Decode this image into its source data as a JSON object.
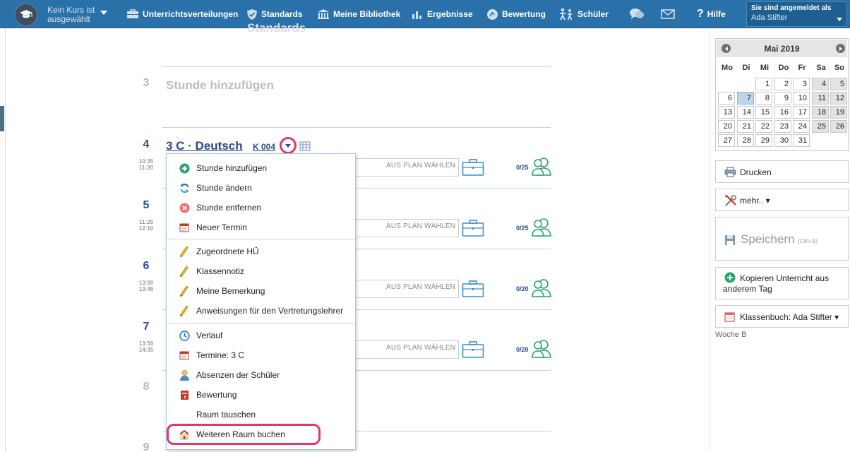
{
  "topbar": {
    "kurs_line1": "Kein Kurs ist",
    "kurs_line2": "ausgewählt",
    "nav": [
      {
        "label": "Unterrichtsverteilungen",
        "icon": "briefcase-icon"
      },
      {
        "label": "Standards",
        "icon": "shield-check-icon"
      },
      {
        "label": "Meine Bibliothek",
        "icon": "library-icon"
      },
      {
        "label": "Ergebnisse",
        "icon": "bar-chart-icon"
      },
      {
        "label": "Bewertung",
        "icon": "gauge-icon"
      },
      {
        "label": "Schüler",
        "icon": "students-icon"
      }
    ],
    "help_label": "Hilfe",
    "user_line1": "Sie sind angemeldet als",
    "user_name": "Ada Stifter"
  },
  "lessons": {
    "slot3": {
      "number": "3",
      "add_label": "Stunde hinzufügen"
    },
    "slot4": {
      "number": "4",
      "start": "10:35",
      "end": "11:20",
      "title": "3 C · Deutsch",
      "room": "K 004",
      "plan_label": "AUS PLAN WÄHLEN",
      "count": "0/25"
    },
    "slot5": {
      "number": "5",
      "start": "11:25",
      "end": "12:10",
      "plan_label": "AUS PLAN WÄHLEN",
      "count": "0/25"
    },
    "slot6": {
      "number": "6",
      "start": "13:00",
      "end": "13:45",
      "plan_label": "AUS PLAN WÄHLEN",
      "count": "0/20"
    },
    "slot7": {
      "number": "7",
      "start": "13:50",
      "end": "14:35",
      "plan_label": "AUS PLAN WÄHLEN",
      "count": "0/20"
    },
    "slot8": {
      "number": "8"
    },
    "slot9": {
      "number": "9"
    }
  },
  "menu": {
    "items": [
      {
        "label": "Stunde hinzufügen",
        "icon": "plus-circle-icon"
      },
      {
        "label": "Stunde ändern",
        "icon": "refresh-icon"
      },
      {
        "label": "Stunde entfernen",
        "icon": "remove-circle-icon"
      },
      {
        "label": "Neuer Termin",
        "icon": "calendar-page-icon"
      },
      {
        "label": "Zugeordnete HÜ",
        "icon": "pencil-icon"
      },
      {
        "label": "Klassennotiz",
        "icon": "pencil-icon"
      },
      {
        "label": "Meine Bemerkung",
        "icon": "pencil-icon"
      },
      {
        "label": "Anweisungen für den Vertretungslehrer",
        "icon": "pencil-icon"
      },
      {
        "label": "Verlauf",
        "icon": "clock-icon"
      },
      {
        "label": "Termine: 3 C",
        "icon": "calendar-page-icon"
      },
      {
        "label": "Absenzen der Schüler",
        "icon": "person-icon"
      },
      {
        "label": "Bewertung",
        "icon": "book-icon"
      },
      {
        "label": "Raum tauschen",
        "icon": ""
      },
      {
        "label": "Weiteren Raum buchen",
        "icon": "room-icon"
      }
    ]
  },
  "calendar": {
    "title": "Mai 2019",
    "weekdays": [
      "Mo",
      "Di",
      "Mi",
      "Do",
      "Fr",
      "Sa",
      "So"
    ],
    "days": [
      "1",
      "2",
      "3",
      "4",
      "5",
      "6",
      "7",
      "8",
      "9",
      "10",
      "11",
      "12",
      "13",
      "14",
      "15",
      "16",
      "17",
      "18",
      "19",
      "20",
      "21",
      "22",
      "23",
      "24",
      "25",
      "26",
      "27",
      "28",
      "29",
      "30",
      "31"
    ],
    "selected": "7"
  },
  "actions": {
    "print_label": "Drucken",
    "more_label": "mehr.. ▾",
    "save_label": "Speichern",
    "save_hint": "(Ctrl+S)",
    "copy_line1": "Kopieren Unterricht aus",
    "copy_line2": "anderem Tag",
    "classbook_label": "Klassenbuch: Ada Stifter ▾"
  },
  "woche": "Woche B",
  "colors": {
    "topbar": "#2a71a9",
    "accent": "#2b4a8a",
    "highlight": "#e0386b",
    "green": "#2aa36b"
  }
}
